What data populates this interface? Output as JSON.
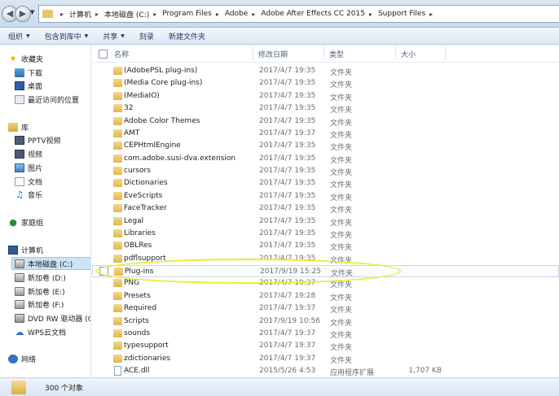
{
  "address": {
    "crumbs": [
      "计算机",
      "本地磁盘 (C:)",
      "Program Files",
      "Adobe",
      "Adobe After Effects CC 2015",
      "Support Files"
    ]
  },
  "toolbar": {
    "organize": "组织",
    "include": "包含到库中",
    "share": "共享",
    "burn": "刻录",
    "new_folder": "新建文件夹"
  },
  "nav": {
    "favorites": "收藏夹",
    "downloads": "下载",
    "desktop": "桌面",
    "recent": "最近访问的位置",
    "libraries": "库",
    "pptv": "PPTV视频",
    "videos": "视频",
    "pictures": "图片",
    "documents": "文档",
    "music": "音乐",
    "homegroup": "家庭组",
    "computer": "计算机",
    "drive_c": "本地磁盘 (C:)",
    "drive_d": "新加卷 (D:)",
    "drive_e": "新加卷 (E:)",
    "drive_f": "新加卷 (F:)",
    "dvd": "DVD RW 驱动器 (G",
    "wps": "WPS云文档",
    "network": "网络"
  },
  "columns": {
    "name": "名称",
    "date": "修改日期",
    "type": "类型",
    "size": "大小"
  },
  "files": [
    {
      "name": "(AdobePSL plug-ins)",
      "date": "2017/4/7 19:35",
      "type": "文件夹",
      "size": "",
      "kind": "folder"
    },
    {
      "name": "(Media Core plug-ins)",
      "date": "2017/4/7 19:35",
      "type": "文件夹",
      "size": "",
      "kind": "folder"
    },
    {
      "name": "(MediaIO)",
      "date": "2017/4/7 19:35",
      "type": "文件夹",
      "size": "",
      "kind": "folder"
    },
    {
      "name": "32",
      "date": "2017/4/7 19:35",
      "type": "文件夹",
      "size": "",
      "kind": "folder"
    },
    {
      "name": "Adobe Color Themes",
      "date": "2017/4/7 19:35",
      "type": "文件夹",
      "size": "",
      "kind": "folder"
    },
    {
      "name": "AMT",
      "date": "2017/4/7 19:37",
      "type": "文件夹",
      "size": "",
      "kind": "folder"
    },
    {
      "name": "CEPHtmlEngine",
      "date": "2017/4/7 19:35",
      "type": "文件夹",
      "size": "",
      "kind": "folder"
    },
    {
      "name": "com.adobe.susi-dva.extension",
      "date": "2017/4/7 19:35",
      "type": "文件夹",
      "size": "",
      "kind": "folder"
    },
    {
      "name": "cursors",
      "date": "2017/4/7 19:35",
      "type": "文件夹",
      "size": "",
      "kind": "folder"
    },
    {
      "name": "Dictionaries",
      "date": "2017/4/7 19:35",
      "type": "文件夹",
      "size": "",
      "kind": "folder"
    },
    {
      "name": "EveScripts",
      "date": "2017/4/7 19:35",
      "type": "文件夹",
      "size": "",
      "kind": "folder"
    },
    {
      "name": "FaceTracker",
      "date": "2017/4/7 19:35",
      "type": "文件夹",
      "size": "",
      "kind": "folder"
    },
    {
      "name": "Legal",
      "date": "2017/4/7 19:35",
      "type": "文件夹",
      "size": "",
      "kind": "folder"
    },
    {
      "name": "Libraries",
      "date": "2017/4/7 19:35",
      "type": "文件夹",
      "size": "",
      "kind": "folder"
    },
    {
      "name": "OBLRes",
      "date": "2017/4/7 19:35",
      "type": "文件夹",
      "size": "",
      "kind": "folder"
    },
    {
      "name": "pdflsupport",
      "date": "2017/4/7 19:35",
      "type": "文件夹",
      "size": "",
      "kind": "folder"
    },
    {
      "name": "Plug-ins",
      "date": "2017/9/19 15:25",
      "type": "文件夹",
      "size": "",
      "kind": "folder",
      "selected": true
    },
    {
      "name": "PNG",
      "date": "2017/4/7 19:37",
      "type": "文件夹",
      "size": "",
      "kind": "folder"
    },
    {
      "name": "Presets",
      "date": "2017/4/7 19:28",
      "type": "文件夹",
      "size": "",
      "kind": "folder"
    },
    {
      "name": "Required",
      "date": "2017/4/7 19:37",
      "type": "文件夹",
      "size": "",
      "kind": "folder"
    },
    {
      "name": "Scripts",
      "date": "2017/9/19 10:56",
      "type": "文件夹",
      "size": "",
      "kind": "folder"
    },
    {
      "name": "sounds",
      "date": "2017/4/7 19:37",
      "type": "文件夹",
      "size": "",
      "kind": "folder"
    },
    {
      "name": "typesupport",
      "date": "2017/4/7 19:37",
      "type": "文件夹",
      "size": "",
      "kind": "folder"
    },
    {
      "name": "zdictionaries",
      "date": "2017/4/7 19:37",
      "type": "文件夹",
      "size": "",
      "kind": "folder"
    },
    {
      "name": "ACE.dll",
      "date": "2015/5/26 4:53",
      "type": "应用程序扩展",
      "size": "1,707 KB",
      "kind": "file"
    }
  ],
  "status": {
    "count": "300 个对象"
  },
  "colors": {
    "highlight": "#ecec2e",
    "selected_nav": "#cce4f7"
  }
}
